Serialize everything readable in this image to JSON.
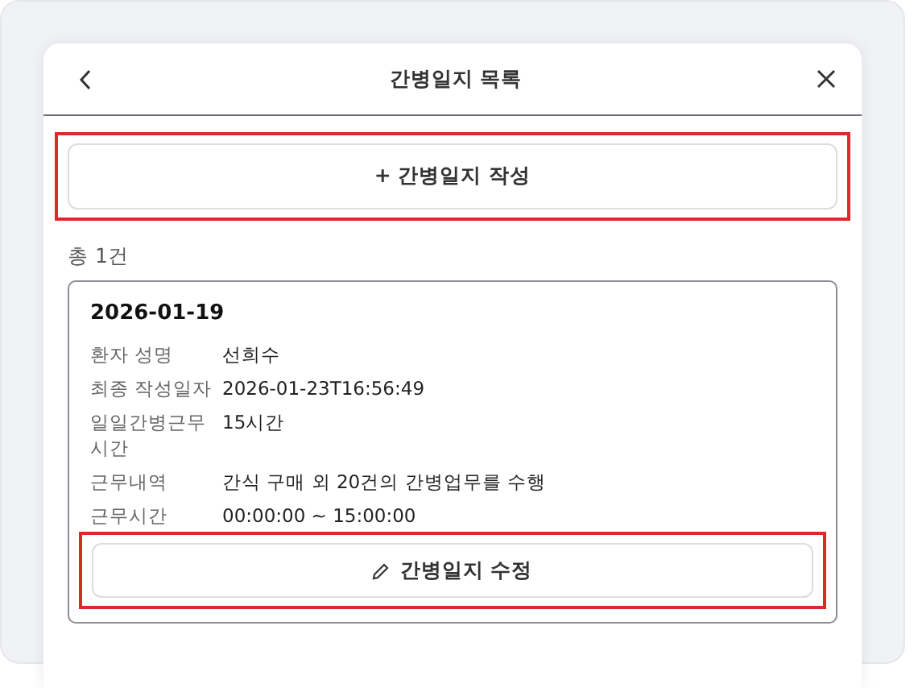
{
  "dialog": {
    "title": "간병일지 목록"
  },
  "create_button": {
    "label": "+ 간병일지 작성",
    "highlighted": true
  },
  "total_count": "총 1건",
  "records": [
    {
      "date": "2026-01-19",
      "fields": [
        {
          "label": "환자 성명",
          "value": "선희수"
        },
        {
          "label": "최종 작성일자",
          "value": "2026-01-23T16:56:49"
        },
        {
          "label": "일일간병근무시간",
          "value": "15시간"
        },
        {
          "label": "근무내역",
          "value": "간식 구매 외 20건의 간병업무를 수행"
        },
        {
          "label": "근무시간",
          "value": "00:00:00 ~ 15:00:00"
        }
      ],
      "edit_button": {
        "label": "간병일지 수정",
        "highlighted": true
      }
    }
  ]
}
